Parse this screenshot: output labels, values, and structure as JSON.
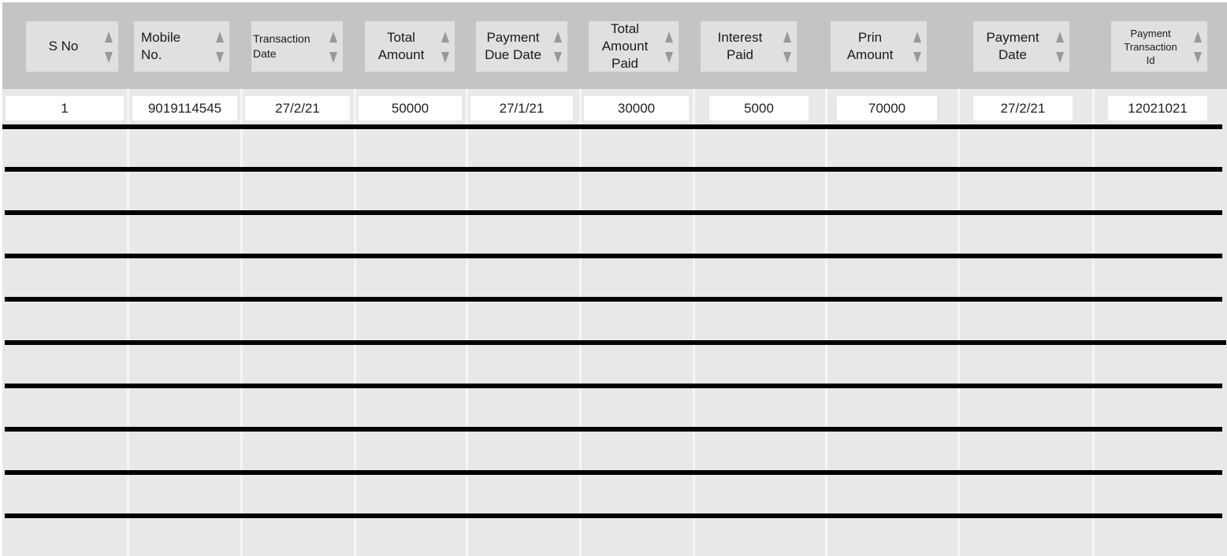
{
  "table": {
    "columns": [
      {
        "key": "s_no",
        "label": "S No"
      },
      {
        "key": "mobile_no",
        "label": "Mobile\nNo."
      },
      {
        "key": "transaction_date",
        "label": "Transaction\nDate"
      },
      {
        "key": "total_amount",
        "label": "Total\nAmount"
      },
      {
        "key": "payment_due_date",
        "label": "Payment\nDue Date"
      },
      {
        "key": "total_amount_paid",
        "label": "Total\nAmount\nPaid"
      },
      {
        "key": "interest_paid",
        "label": "Interest\nPaid"
      },
      {
        "key": "prin_amount",
        "label": "Prin\nAmount"
      },
      {
        "key": "payment_date",
        "label": "Payment\nDate"
      },
      {
        "key": "payment_transaction_id",
        "label": "Payment\nTransaction\nId"
      }
    ],
    "rows": [
      [
        "1",
        "9019114545",
        "27/2/21",
        "50000",
        "27/1/21",
        "30000",
        "5000",
        "70000",
        "27/2/21",
        "12021021"
      ]
    ],
    "empty_row_count": 10,
    "sort_icons": "sort-up-down-icon"
  },
  "colors": {
    "header_bg": "#c4c4c4",
    "header_cell_bg": "#e0e0e0",
    "body_bg": "#e8e8e8",
    "row_rule": "#000000"
  }
}
